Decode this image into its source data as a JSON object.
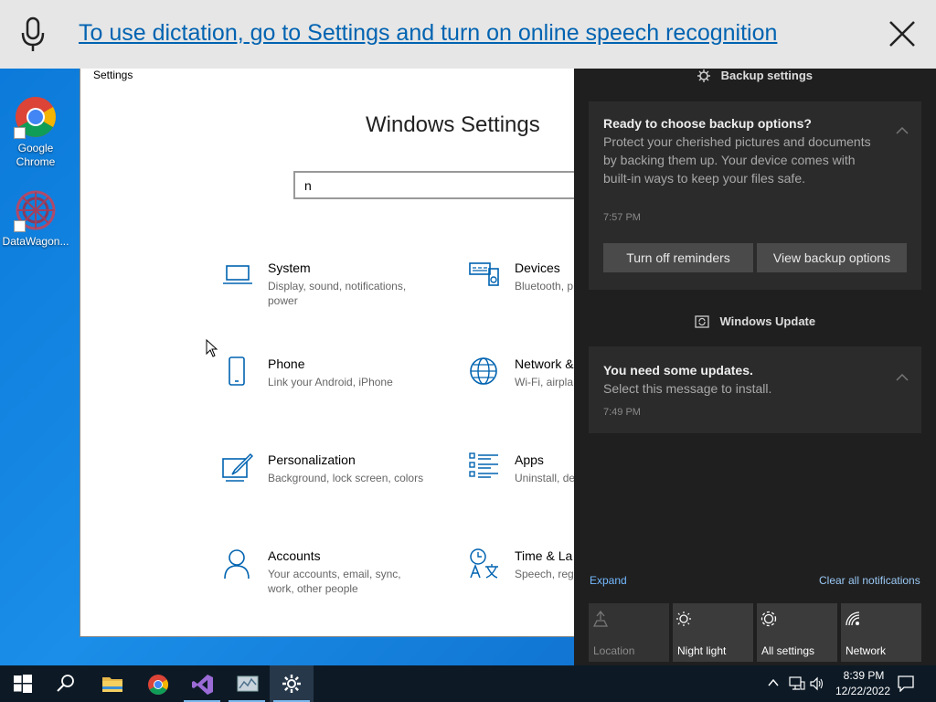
{
  "dictation": {
    "message": "To use dictation, go to Settings and turn on online speech recognition"
  },
  "desktop": {
    "icons": [
      {
        "label": "Google Chrome"
      },
      {
        "label": "DataWagon..."
      }
    ]
  },
  "settings": {
    "window_title": "Settings",
    "heading": "Windows Settings",
    "search_value": "n",
    "tiles": [
      {
        "name": "System",
        "desc": "Display, sound, notifications, power"
      },
      {
        "name": "Devices",
        "desc": "Bluetooth, p"
      },
      {
        "name": "Phone",
        "desc": "Link your Android, iPhone"
      },
      {
        "name": "Network &",
        "desc": "Wi-Fi, airpla"
      },
      {
        "name": "Personalization",
        "desc": "Background, lock screen, colors"
      },
      {
        "name": "Apps",
        "desc": "Uninstall, de features"
      },
      {
        "name": "Accounts",
        "desc": "Your accounts, email, sync, work, other people"
      },
      {
        "name": "Time & La",
        "desc": "Speech, reg"
      }
    ]
  },
  "action_center": {
    "backup_group": "Backup settings",
    "backup_card": {
      "title": "Ready to choose backup options?",
      "body": "Protect your cherished pictures and documents by backing them up. Your device comes with built-in ways to keep your files safe.",
      "time": "7:57 PM",
      "btn_off": "Turn off reminders",
      "btn_view": "View backup options"
    },
    "update_group": "Windows Update",
    "update_card": {
      "title": "You need some updates.",
      "body": "Select this message to install.",
      "time": "7:49 PM"
    },
    "expand": "Expand",
    "clear_all": "Clear all notifications",
    "quick_actions": [
      {
        "label": "Location",
        "icon": "location-icon"
      },
      {
        "label": "Night light",
        "icon": "night-light-icon"
      },
      {
        "label": "All settings",
        "icon": "gear-icon"
      },
      {
        "label": "Network",
        "icon": "network-icon"
      }
    ]
  },
  "taskbar": {
    "time": "8:39 PM",
    "date": "12/22/2022"
  },
  "colors": {
    "accent": "#0063b1",
    "action_center_bg": "#1f1f1f",
    "taskbar_bg": "#0d1a26"
  }
}
